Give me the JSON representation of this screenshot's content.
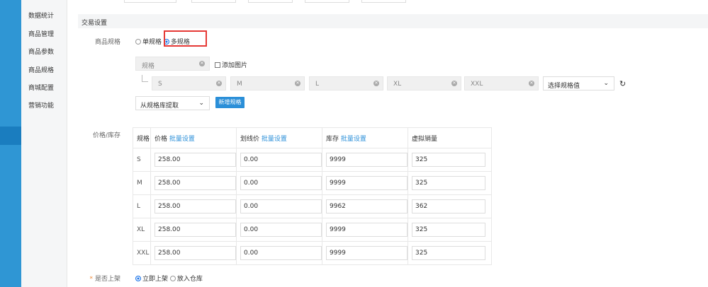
{
  "sidebar": {
    "items": [
      {
        "label": "数据统计"
      },
      {
        "label": "商品管理"
      },
      {
        "label": "商品参数"
      },
      {
        "label": "商品规格"
      },
      {
        "label": "商城配置"
      },
      {
        "label": "营销功能"
      }
    ]
  },
  "section": {
    "title": "交易设置"
  },
  "spec_type": {
    "label": "商品规格",
    "options": [
      {
        "label": "单规格",
        "selected": false
      },
      {
        "label": "多规格",
        "selected": true
      }
    ]
  },
  "spec_name": {
    "value": "规格",
    "add_image_label": "添加图片"
  },
  "spec_values": [
    "S",
    "M",
    "L",
    "XL",
    "XXL"
  ],
  "spec_value_select": {
    "value": "选择规格值"
  },
  "spec_library": {
    "value": "从规格库提取",
    "add_button": "新增规格"
  },
  "price_stock": {
    "label": "价格/库存",
    "headers": {
      "spec": "规格",
      "price": "价格",
      "line_price": "划线价",
      "stock": "库存",
      "virtual_sales": "虚拟销量",
      "batch": "批量设置"
    },
    "rows": [
      {
        "size": "S",
        "price": "258.00",
        "line_price": "0.00",
        "stock": "9999",
        "sales": "325"
      },
      {
        "size": "M",
        "price": "258.00",
        "line_price": "0.00",
        "stock": "9999",
        "sales": "325"
      },
      {
        "size": "L",
        "price": "258.00",
        "line_price": "0.00",
        "stock": "9962",
        "sales": "362"
      },
      {
        "size": "XL",
        "price": "258.00",
        "line_price": "0.00",
        "stock": "9999",
        "sales": "325"
      },
      {
        "size": "XXL",
        "price": "258.00",
        "line_price": "0.00",
        "stock": "9999",
        "sales": "325"
      }
    ]
  },
  "listing": {
    "required_mark": "*",
    "label": "是否上架",
    "options": [
      {
        "label": "立即上架",
        "selected": true
      },
      {
        "label": "放入仓库",
        "selected": false
      }
    ]
  },
  "colors": {
    "accent": "#2b8fd8",
    "sidebar_strip": "#2f96d4",
    "highlight_border": "#e53935",
    "required": "#f08b3a"
  }
}
